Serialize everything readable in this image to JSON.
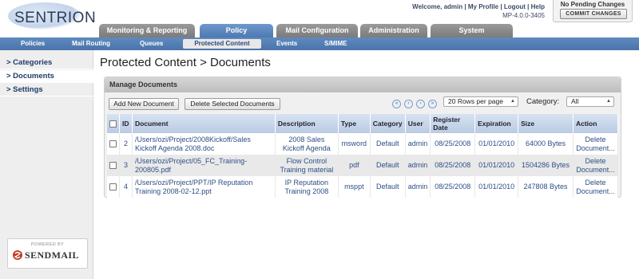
{
  "brand": {
    "logo_text": "SENTRION"
  },
  "header": {
    "welcome": "Welcome, admin",
    "my_profile": "My Profile",
    "logout": "Logout",
    "help": "Help",
    "separator": "|",
    "version": "MP-4.0.0-3405",
    "pending": "No Pending Changes",
    "commit_label": "COMMIT CHANGES"
  },
  "top_tabs": [
    {
      "label": "Monitoring & Reporting",
      "active": false
    },
    {
      "label": "Policy",
      "active": true
    },
    {
      "label": "Mail Configuration",
      "active": false
    },
    {
      "label": "Administration",
      "active": false
    },
    {
      "label": "System",
      "active": false
    }
  ],
  "sub_nav": [
    {
      "label": "Policies",
      "active": false
    },
    {
      "label": "Mail Routing",
      "active": false
    },
    {
      "label": "Queues",
      "active": false
    },
    {
      "label": "Protected Content",
      "active": true
    },
    {
      "label": "Events",
      "active": false
    },
    {
      "label": "S/MIME",
      "active": false
    }
  ],
  "sidebar": {
    "items": [
      {
        "label": "> Categories"
      },
      {
        "label": "> Documents"
      },
      {
        "label": "> Settings"
      }
    ],
    "powered_by": "POWERED BY",
    "powered_name": "SENDMAIL"
  },
  "page": {
    "title": "Protected Content > Documents"
  },
  "panel": {
    "title": "Manage Documents",
    "add_button": "Add New Document",
    "delete_button": "Delete Selected Documents",
    "rows_per_page": "20 Rows per page",
    "category_label": "Category:",
    "category_value": "All"
  },
  "table": {
    "columns": [
      "",
      "ID",
      "Document",
      "Description",
      "Type",
      "Category",
      "User",
      "Register Date",
      "Expiration",
      "Size",
      "Action"
    ],
    "rows": [
      {
        "id": "2",
        "document": "/Users/ozi/Project/2008Kickoff/Sales Kickoff Agenda 2008.doc",
        "description": "2008 Sales Kickoff Agenda",
        "type": "msword",
        "category": "Default",
        "user": "admin",
        "register_date": "08/25/2008",
        "expiration": "01/01/2010",
        "size": "64000 Bytes",
        "action": "Delete Document..."
      },
      {
        "id": "3",
        "document": "/Users/ozi/Project/05_FC_Training-200805.pdf",
        "description": "Flow Control Training material",
        "type": "pdf",
        "category": "Default",
        "user": "admin",
        "register_date": "08/25/2008",
        "expiration": "01/01/2010",
        "size": "1504286 Bytes",
        "action": "Delete Document..."
      },
      {
        "id": "4",
        "document": "/Users/ozi/Project/PPT/IP Reputation Training 2008-02-12.ppt",
        "description": "IP Reputation Training 2008",
        "type": "msppt",
        "category": "Default",
        "user": "admin",
        "register_date": "08/25/2008",
        "expiration": "01/01/2010",
        "size": "247808 Bytes",
        "action": "Delete Document..."
      }
    ]
  }
}
